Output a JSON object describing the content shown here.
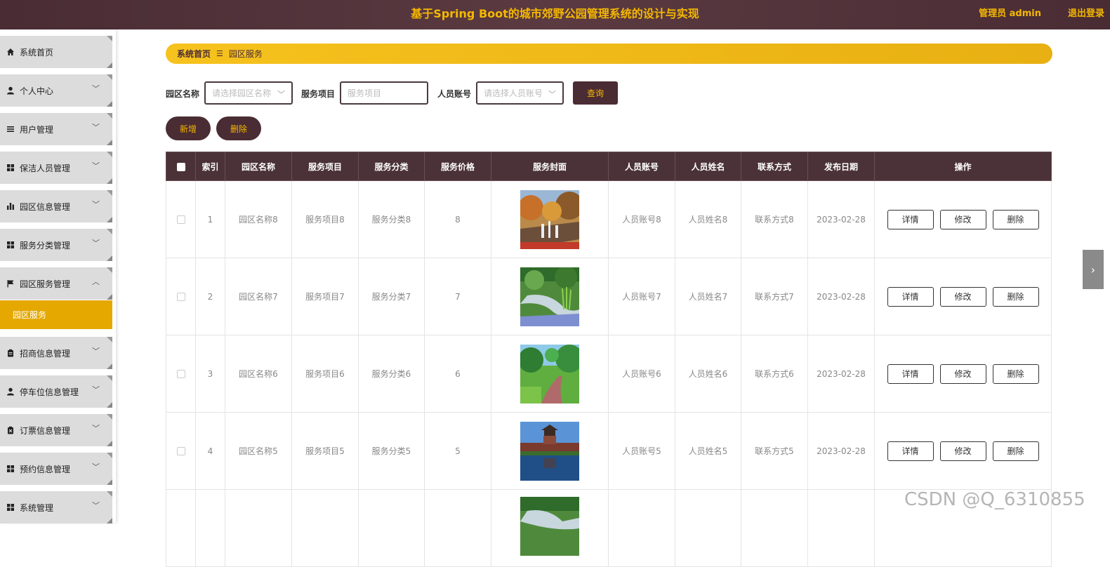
{
  "header": {
    "title": "基于Spring Boot的城市郊野公园管理系统的设计与实现",
    "user": "管理员 admin",
    "logout": "退出登录"
  },
  "sidebar": {
    "items": [
      {
        "label": "系统首页",
        "icon": "home-icon",
        "expandable": false
      },
      {
        "label": "个人中心",
        "icon": "person-icon",
        "expandable": true
      },
      {
        "label": "用户管理",
        "icon": "list-icon",
        "expandable": true
      },
      {
        "label": "保洁人员管理",
        "icon": "grid-icon",
        "expandable": true
      },
      {
        "label": "园区信息管理",
        "icon": "bar-chart-icon",
        "expandable": true
      },
      {
        "label": "服务分类管理",
        "icon": "grid-icon",
        "expandable": true
      },
      {
        "label": "园区服务管理",
        "icon": "flag-icon",
        "expandable": true,
        "expanded": true
      },
      {
        "label": "招商信息管理",
        "icon": "clipboard-icon",
        "expandable": true
      },
      {
        "label": "停车位信息管理",
        "icon": "person-icon",
        "expandable": true
      },
      {
        "label": "订票信息管理",
        "icon": "clipboard-x-icon",
        "expandable": true
      },
      {
        "label": "预约信息管理",
        "icon": "grid-icon",
        "expandable": true
      },
      {
        "label": "系统管理",
        "icon": "grid-icon",
        "expandable": true
      }
    ],
    "active_sub": "园区服务"
  },
  "breadcrumb": {
    "home": "系统首页",
    "sep": "☰",
    "current": "园区服务"
  },
  "search": {
    "park_label": "园区名称",
    "park_placeholder": "请选择园区名称",
    "service_label": "服务项目",
    "service_placeholder": "服务项目",
    "account_label": "人员账号",
    "account_placeholder": "请选择人员账号",
    "query": "查询"
  },
  "actions": {
    "add": "新增",
    "delete": "删除"
  },
  "table": {
    "headers": [
      "索引",
      "园区名称",
      "服务项目",
      "服务分类",
      "服务价格",
      "服务封面",
      "人员账号",
      "人员姓名",
      "联系方式",
      "发布日期",
      "操作"
    ],
    "rows": [
      {
        "index": "1",
        "park": "园区名称8",
        "service": "服务项目8",
        "category": "服务分类8",
        "price": "8",
        "cover": "autumn-fountain-photo",
        "account": "人员账号8",
        "name": "人员姓名8",
        "contact": "联系方式8",
        "date": "2023-02-28"
      },
      {
        "index": "2",
        "park": "园区名称7",
        "service": "服务项目7",
        "category": "服务分类7",
        "price": "7",
        "cover": "garden-stream-photo",
        "account": "人员账号7",
        "name": "人员姓名7",
        "contact": "联系方式7",
        "date": "2023-02-28"
      },
      {
        "index": "3",
        "park": "园区名称6",
        "service": "服务项目6",
        "category": "服务分类6",
        "price": "6",
        "cover": "park-path-photo",
        "account": "人员账号6",
        "name": "人员姓名6",
        "contact": "联系方式6",
        "date": "2023-02-28"
      },
      {
        "index": "4",
        "park": "园区名称5",
        "service": "服务项目5",
        "category": "服务分类5",
        "price": "5",
        "cover": "tower-reflection-photo",
        "account": "人员账号5",
        "name": "人员姓名5",
        "contact": "联系方式5",
        "date": "2023-02-28"
      }
    ],
    "row_buttons": {
      "detail": "详情",
      "edit": "修改",
      "delete": "删除"
    }
  },
  "watermark": "CSDN @Q_6310855"
}
